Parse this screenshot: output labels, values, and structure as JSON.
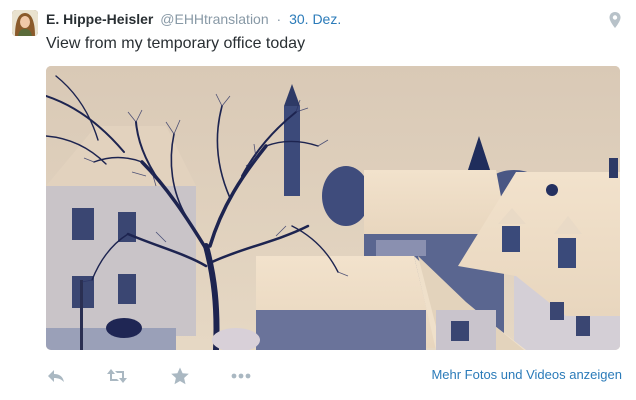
{
  "tweet": {
    "fullname": "E. Hippe-Heisler",
    "username": "@EHHtranslation",
    "separator": "·",
    "timestamp": "30. Dez.",
    "text": "View from my temporary office today",
    "geo_icon": "location-pin-icon"
  },
  "media": {
    "alt": "snowy rooftops and bare tree, tinted photo"
  },
  "actions": {
    "reply_icon": "reply-icon",
    "retweet_icon": "retweet-icon",
    "favorite_icon": "star-icon",
    "more_icon": "more-dots-icon",
    "more_media_label": "Mehr Fotos und Videos anzeigen"
  },
  "colors": {
    "link": "#2b7bb9",
    "muted": "#8899a6",
    "icon": "#aab8c2",
    "text": "#292f33"
  }
}
